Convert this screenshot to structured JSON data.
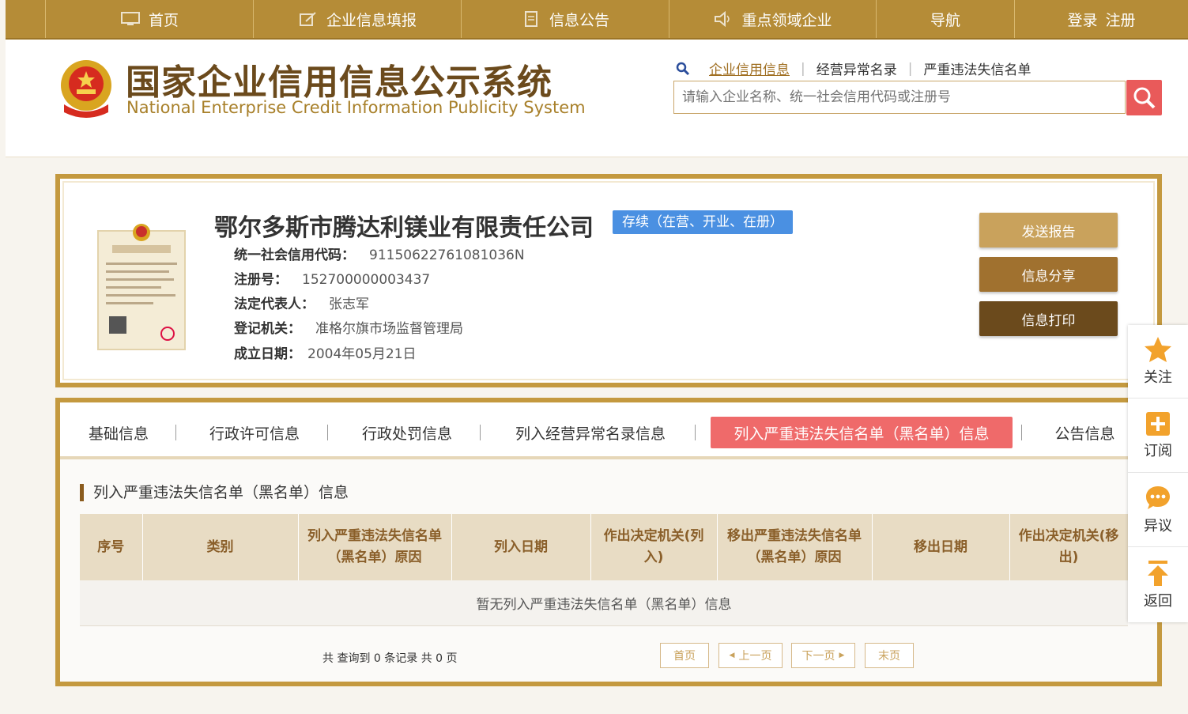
{
  "topnav": {
    "home": "首页",
    "fill": "企业信息填报",
    "notice": "信息公告",
    "key": "重点领域企业",
    "nav": "导航",
    "login": "登录",
    "register": "注册"
  },
  "header": {
    "title_cn": "国家企业信用信息公示系统",
    "title_en": "National Enterprise Credit Information Publicity System",
    "search_links": [
      "企业信用信息",
      "经营异常名录",
      "严重违法失信名单"
    ],
    "search_placeholder": "请输入企业名称、统一社会信用代码或注册号"
  },
  "company": {
    "name": "鄂尔多斯市腾达利镁业有限责任公司",
    "status": "存续（在营、开业、在册）",
    "fields": [
      {
        "label": "统一社会信用代码：",
        "value": "91150622761081036N"
      },
      {
        "label": "注册号：",
        "value": "152700000003437"
      },
      {
        "label": "法定代表人：",
        "value": "张志军"
      },
      {
        "label": "登记机关：",
        "value": "准格尔旗市场监督管理局"
      },
      {
        "label": "成立日期：",
        "value": "2004年05月21日"
      }
    ],
    "actions": [
      "发送报告",
      "信息分享",
      "信息打印"
    ]
  },
  "tabs": [
    {
      "label": "基础信息"
    },
    {
      "label": "行政许可信息"
    },
    {
      "label": "行政处罚信息"
    },
    {
      "label": "列入经营异常名录信息"
    },
    {
      "label": "列入严重违法失信名单（黑名单）信息",
      "active": true
    },
    {
      "label": "公告信息"
    }
  ],
  "section": {
    "title": "列入严重违法失信名单（黑名单）信息",
    "columns": [
      "序号",
      "类别",
      "列入严重违法失信名单（黑名单）原因",
      "列入日期",
      "作出决定机关(列入)",
      "移出严重违法失信名单（黑名单）原因",
      "移出日期",
      "作出决定机关(移出)"
    ],
    "empty": "暂无列入严重违法失信名单（黑名单）信息"
  },
  "pager": {
    "summary": "共 查询到 0 条记录 共 0 页",
    "first": "首页",
    "prev": "上一页",
    "next": "下一页",
    "last": "末页"
  },
  "side": {
    "follow": "关注",
    "subscribe": "订阅",
    "objection": "异议",
    "back": "返回"
  },
  "colors": {
    "gold": "#b58c37",
    "brown": "#6b4a1c",
    "active_tab": "#ef6a6a",
    "status": "#4a90e2"
  }
}
